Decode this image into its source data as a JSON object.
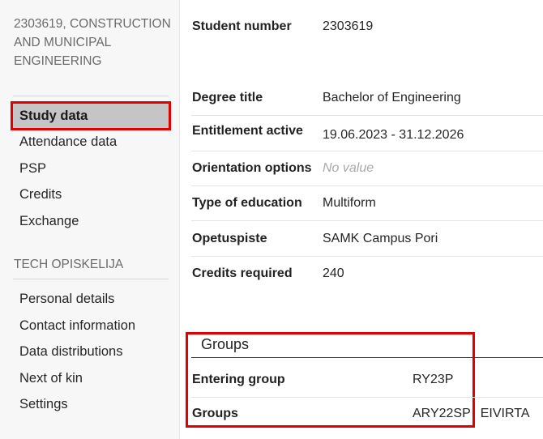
{
  "sidebar": {
    "student_header": "2303619, CONSTRUCTION AND MUNICIPAL ENGINEERING",
    "study_nav": [
      "Study data",
      "Attendance data",
      "PSP",
      "Credits",
      "Exchange"
    ],
    "section_label": "TECH OPISKELIJA",
    "personal_nav": [
      "Personal details",
      "Contact information",
      "Data distributions",
      "Next of kin",
      "Settings"
    ]
  },
  "main": {
    "student_number": {
      "label": "Student number",
      "value": "2303619"
    },
    "details": [
      {
        "label": "Degree title",
        "value": "Bachelor of Engineering"
      },
      {
        "label": "Entitlement active",
        "value": "19.06.2023 - 31.12.2026"
      },
      {
        "label": "Orientation options",
        "value": "No value"
      },
      {
        "label": "Type of education",
        "value": "Multiform"
      },
      {
        "label": "Opetuspiste",
        "value": "SAMK Campus Pori"
      },
      {
        "label": "Credits required",
        "value": "240"
      }
    ],
    "groups": {
      "title": "Groups",
      "rows": [
        {
          "label": "Entering group",
          "values": [
            "RY23P"
          ]
        },
        {
          "label": "Groups",
          "values": [
            "ARY22SP",
            "EIVIRTA"
          ]
        }
      ]
    }
  },
  "colors": {
    "highlight": "#e00000",
    "active_bg": "#c5c5c5"
  }
}
